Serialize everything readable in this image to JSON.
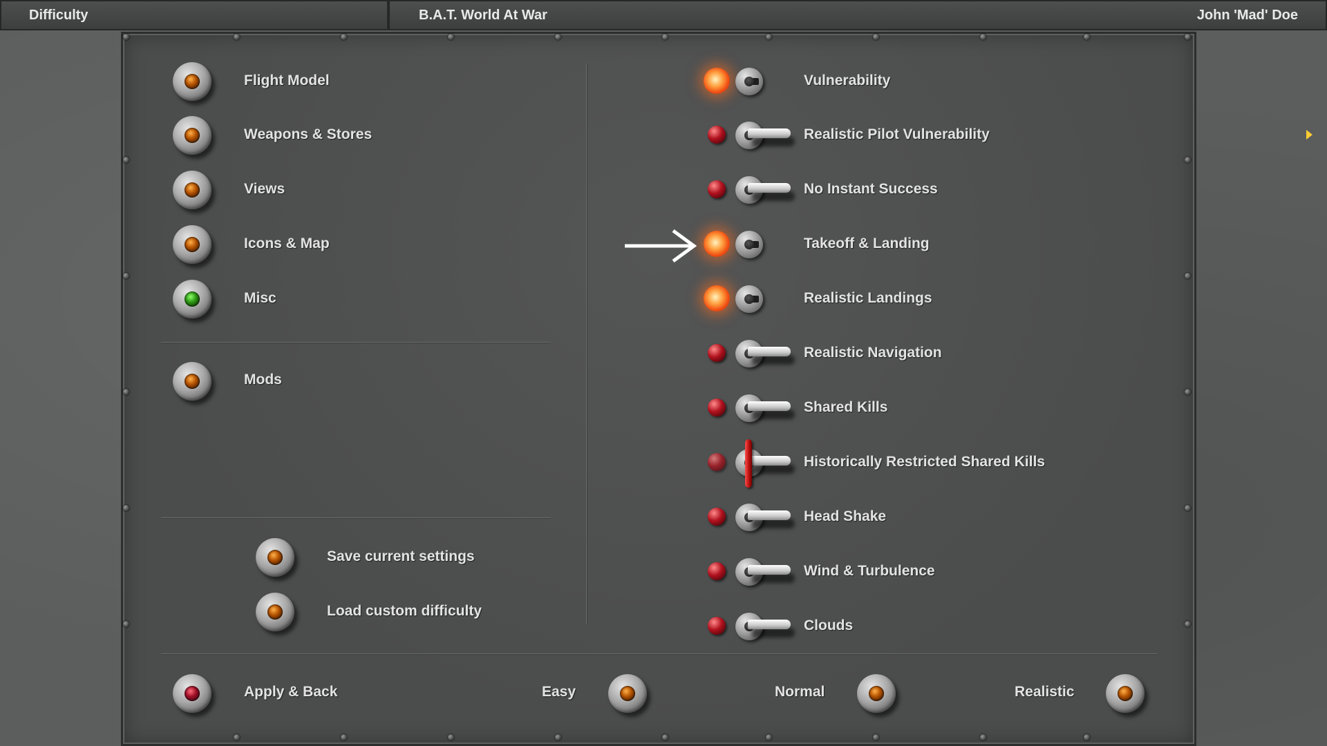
{
  "titlebar": {
    "section": "Difficulty",
    "title": "B.A.T. World At War",
    "user": "John 'Mad' Doe"
  },
  "left_menu": {
    "items": [
      {
        "label": "Flight Model",
        "lamp": "amber"
      },
      {
        "label": "Weapons & Stores",
        "lamp": "amber"
      },
      {
        "label": "Views",
        "lamp": "amber"
      },
      {
        "label": "Icons & Map",
        "lamp": "amber"
      },
      {
        "label": "Misc",
        "lamp": "green"
      },
      {
        "label": "Mods",
        "lamp": "amber"
      }
    ],
    "save_label": "Save current settings",
    "load_label": "Load custom difficulty"
  },
  "options": [
    {
      "label": "Vulnerability",
      "state": "on"
    },
    {
      "label": "Realistic Pilot Vulnerability",
      "state": "off"
    },
    {
      "label": "No Instant Success",
      "state": "off"
    },
    {
      "label": "Takeoff & Landing",
      "state": "on"
    },
    {
      "label": "Realistic Landings",
      "state": "on"
    },
    {
      "label": "Realistic Navigation",
      "state": "off"
    },
    {
      "label": "Shared Kills",
      "state": "off"
    },
    {
      "label": "Historically Restricted Shared Kills",
      "state": "locked"
    },
    {
      "label": "Head Shake",
      "state": "off"
    },
    {
      "label": "Wind & Turbulence",
      "state": "off"
    },
    {
      "label": "Clouds",
      "state": "off"
    }
  ],
  "footer": {
    "apply_label": "Apply & Back",
    "easy_label": "Easy",
    "normal_label": "Normal",
    "realistic_label": "Realistic"
  },
  "colors": {
    "panel": "#4b4c4c",
    "background": "#5c5e5e",
    "lamp_amber": "#b55300",
    "lamp_green": "#2d9a14",
    "toggle_on": "#ffa040",
    "toggle_off": "#b0121e"
  }
}
